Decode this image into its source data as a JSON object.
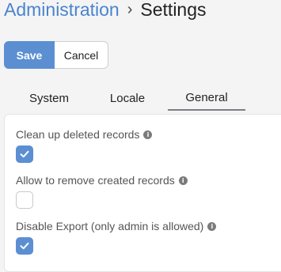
{
  "breadcrumb": {
    "parent": "Administration",
    "separator": "›",
    "current": "Settings"
  },
  "toolbar": {
    "save_label": "Save",
    "cancel_label": "Cancel"
  },
  "tabs": [
    {
      "label": "System",
      "active": false
    },
    {
      "label": "Locale",
      "active": false
    },
    {
      "label": "General",
      "active": true
    }
  ],
  "fields": [
    {
      "label": "Clean up deleted records",
      "checked": true,
      "icon": "info-icon"
    },
    {
      "label": "Allow to remove created records",
      "checked": false,
      "icon": "info-icon"
    },
    {
      "label": "Disable Export (only admin is allowed)",
      "checked": true,
      "icon": "info-icon"
    }
  ],
  "colors": {
    "accent": "#5b8fd2",
    "breadcrumb_link": "#4a84cc"
  }
}
